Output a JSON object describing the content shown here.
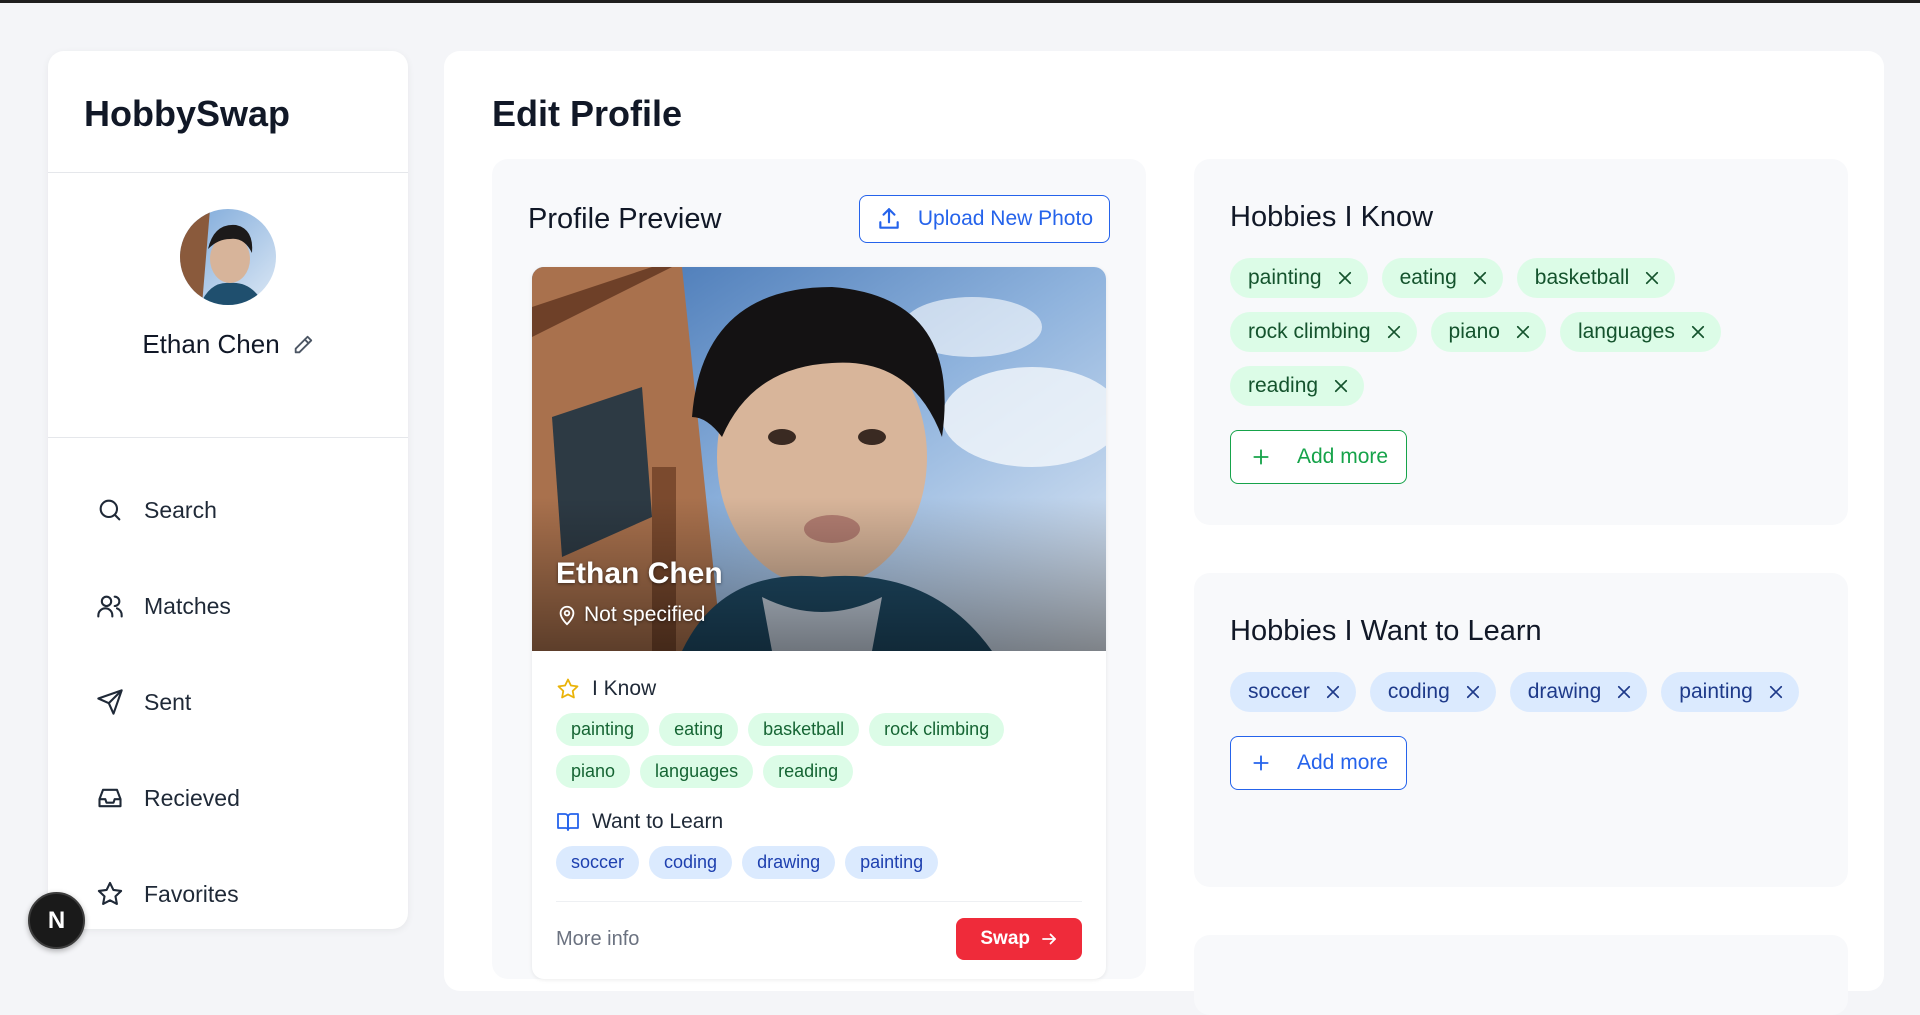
{
  "app": {
    "name": "HobbySwap"
  },
  "user": {
    "name": "Ethan Chen"
  },
  "nav": {
    "items": [
      {
        "label": "Search",
        "icon": "search-icon"
      },
      {
        "label": "Matches",
        "icon": "users-icon"
      },
      {
        "label": "Sent",
        "icon": "send-icon"
      },
      {
        "label": "Recieved",
        "icon": "inbox-icon"
      },
      {
        "label": "Favorites",
        "icon": "star-icon"
      }
    ]
  },
  "badge": {
    "letter": "N"
  },
  "page": {
    "title": "Edit Profile"
  },
  "preview": {
    "title": "Profile Preview",
    "upload_label": "Upload New Photo",
    "card": {
      "name": "Ethan Chen",
      "location": "Not specified",
      "know_label": "I Know",
      "know": [
        "painting",
        "eating",
        "basketball",
        "rock climbing",
        "piano",
        "languages",
        "reading"
      ],
      "learn_label": "Want to Learn",
      "learn": [
        "soccer",
        "coding",
        "drawing",
        "painting"
      ],
      "more_info": "More info",
      "swap_label": "Swap"
    }
  },
  "hobbies_know": {
    "title": "Hobbies I Know",
    "items": [
      "painting",
      "eating",
      "basketball",
      "rock climbing",
      "piano",
      "languages",
      "reading"
    ],
    "add_label": "Add more"
  },
  "hobbies_learn": {
    "title": "Hobbies I Want to Learn",
    "items": [
      "soccer",
      "coding",
      "drawing",
      "painting"
    ],
    "add_label": "Add more"
  },
  "colors": {
    "accent_blue": "#2563eb",
    "accent_green": "#16a34a",
    "swap_red": "#ef2b3a",
    "know_pill_bg": "#dcfce7",
    "learn_pill_bg": "#dbeafe"
  }
}
